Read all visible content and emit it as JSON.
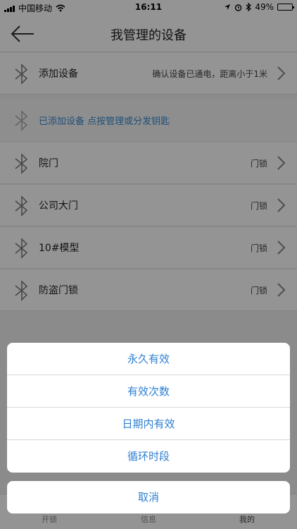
{
  "status_bar": {
    "carrier": "中国移动",
    "time": "16:11",
    "battery": "49%",
    "battery_level": 0.49
  },
  "nav": {
    "title": "我管理的设备"
  },
  "add_device": {
    "label": "添加设备",
    "hint": "确认设备已通电，距离小于1米"
  },
  "section_header": {
    "text": "已添加设备 点按管理或分发钥匙"
  },
  "devices": [
    {
      "name": "院门",
      "type": "门锁"
    },
    {
      "name": "公司大门",
      "type": "门锁"
    },
    {
      "name": "10#模型",
      "type": "门锁"
    },
    {
      "name": "防盗门锁",
      "type": "门锁"
    }
  ],
  "tabs": [
    "开锁",
    "信息",
    "我的"
  ],
  "action_sheet": {
    "options": [
      "永久有效",
      "有效次数",
      "日期内有效",
      "循环时段"
    ],
    "cancel": "取消"
  },
  "colors": {
    "accent": "#2e7fd0",
    "section_text": "#3a8bd1"
  }
}
